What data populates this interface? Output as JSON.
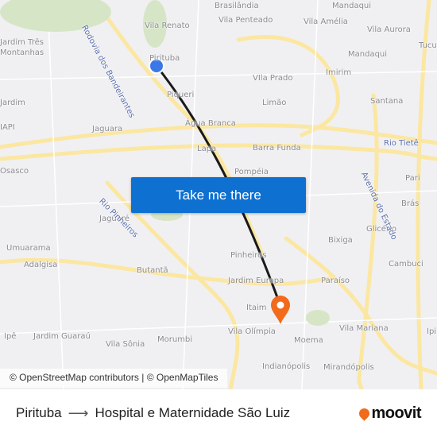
{
  "map": {
    "labels": [
      "Brasilândia",
      "Mandaqui",
      "Vila Renato",
      "Vila Penteado",
      "Vila Amélia",
      "Vila Aurora",
      "Jardim Três",
      "Montanhas",
      "Mandaqui",
      "Tucu",
      "Pirituba",
      "Imirim",
      "VIla Prado",
      "Piqueri",
      "Limão",
      "Santana",
      "Jardim",
      "IAPI",
      "Jaguara",
      "Água Branca",
      "Rio Tietê",
      "Osasco",
      "Lapa",
      "Barra Funda",
      "Pompéia",
      "Pari",
      "Brás",
      "Jaguaré",
      "Glicério",
      "Bixiga",
      "Umuarama",
      "Adalgisa",
      "Pinheiros",
      "Cambuci",
      "Butantã",
      "Jardim Europa",
      "Paraíso",
      "Itaim",
      "Vila Olímpia",
      "Moema",
      "Vila Mariana",
      "Ipi",
      "Ipê",
      "Jardim Guaraú",
      "Vila Sônia",
      "Morumbi",
      "Indianópolis",
      "Mirandópolis",
      "Rodovia dos Bandeirantes",
      "Rio Pinheiros",
      "Avenida do Estado"
    ],
    "attribution": "© OpenStreetMap contributors | © OpenMapTiles",
    "origin_color": "#3b78e7",
    "destination_color": "#f26a1c",
    "route_color": "#1a1a1a"
  },
  "cta": {
    "label": "Take me there",
    "color": "#0e70d1"
  },
  "footer": {
    "origin": "Pirituba",
    "destination": "Hospital e Maternidade São Luiz",
    "brand": "moovit"
  }
}
